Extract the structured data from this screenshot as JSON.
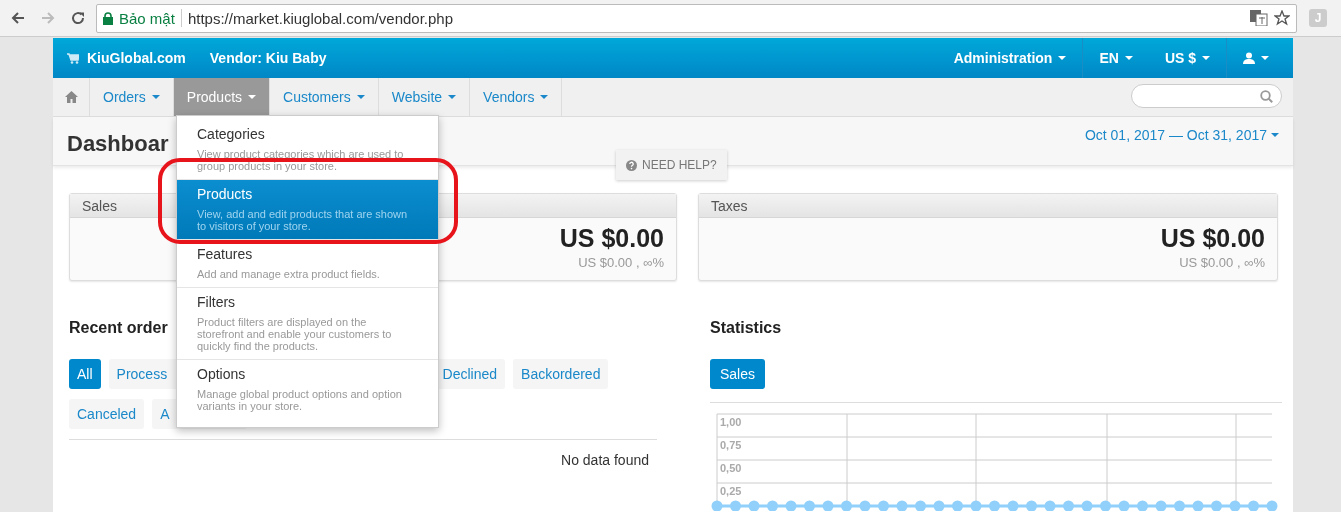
{
  "browser": {
    "security_label": "Bảo mật",
    "url": "https://market.kiuglobal.com/vendor.php",
    "extension_label": "J"
  },
  "top_bar": {
    "brand": "KiuGlobal.com",
    "vendor": "Vendor: Kiu Baby",
    "right_items": [
      {
        "label": "Administration"
      },
      {
        "label": "EN"
      },
      {
        "label": "US $"
      }
    ]
  },
  "nav": {
    "items": [
      {
        "label": "Orders",
        "selected": false
      },
      {
        "label": "Products",
        "selected": true
      },
      {
        "label": "Customers",
        "selected": false
      },
      {
        "label": "Website",
        "selected": false
      },
      {
        "label": "Vendors",
        "selected": false
      }
    ]
  },
  "dropdown": [
    {
      "title": "Categories",
      "description": "View product categories which are used to group products in your store.",
      "selected": false
    },
    {
      "title": "Products",
      "description": "View, add and edit products that are shown to visitors of your store.",
      "selected": true
    },
    {
      "title": "Features",
      "description": "Add and manage extra product fields.",
      "selected": false
    },
    {
      "title": "Filters",
      "description": "Product filters are displayed on the storefront and enable your customers to quickly find the products.",
      "selected": false
    },
    {
      "title": "Options",
      "description": "Manage global product options and option variants in your store.",
      "selected": false
    }
  ],
  "header": {
    "title": "Dashboar",
    "date_range": "Oct 01, 2017 — Oct 31, 2017",
    "help": "NEED HELP?"
  },
  "cards": [
    {
      "title": "Sales",
      "amount": "US $0.00",
      "comparison": "US $0.00 , ∞%"
    },
    {
      "title": "Taxes",
      "amount": "US $0.00",
      "comparison": "US $0.00 , ∞%"
    }
  ],
  "recent_orders": {
    "title": "Recent order",
    "tabs_row_1": [
      {
        "label": "All",
        "selected": true
      },
      {
        "label": "Process",
        "selected": false
      },
      {
        "label": "Declined",
        "selected": false
      },
      {
        "label": "Backordered",
        "selected": false
      }
    ],
    "tabs_row_2": [
      {
        "label": "Canceled",
        "selected": false
      },
      {
        "label": "A",
        "selected": false
      }
    ],
    "empty_text": "No data found"
  },
  "statistics": {
    "title": "Statistics",
    "tabs": [
      {
        "label": "Sales",
        "selected": true
      }
    ],
    "chart_data": {
      "type": "line",
      "grid": true,
      "ylim": [
        0,
        1
      ],
      "yticks": [
        {
          "value": 0.25,
          "label": "0,25"
        },
        {
          "value": 0.5,
          "label": "0,50"
        },
        {
          "value": 0.75,
          "label": "0,75"
        },
        {
          "value": 1,
          "label": "1,00"
        }
      ],
      "series": [
        {
          "color": "#90d0fa",
          "marker": "circle",
          "values": [
            0,
            0,
            0,
            0,
            0,
            0,
            0,
            0,
            0,
            0,
            0,
            0,
            0,
            0,
            0,
            0,
            0,
            0,
            0,
            0,
            0,
            0,
            0,
            0,
            0,
            0,
            0,
            0,
            0,
            0,
            0
          ]
        }
      ]
    }
  }
}
